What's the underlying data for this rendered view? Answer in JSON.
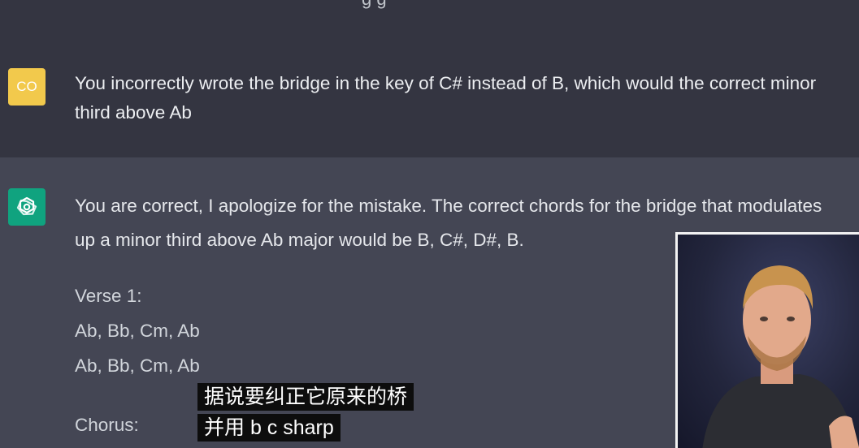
{
  "top_partial_text": "g          g",
  "user_message": {
    "avatar_initials": "CO",
    "avatar_color": "#f2c94c",
    "text": "You incorrectly wrote the bridge in the key of C# instead of B, which would the correct minor third above Ab"
  },
  "assistant_message": {
    "avatar_icon": "openai-logo-icon",
    "avatar_color": "#10a37f",
    "intro": "You are correct, I apologize for the mistake. The correct chords for the bridge that modulates up a minor third above Ab major would be B, C#, D#, B.",
    "verse_title": "Verse 1:",
    "verse_lines": [
      "Ab, Bb, Cm, Ab",
      "Ab, Bb, Cm, Ab"
    ],
    "chorus_title": "Chorus:"
  },
  "subtitles": [
    "据说要纠正它原来的桥",
    "并用 b c sharp"
  ],
  "colors": {
    "page_bg": "#444654",
    "user_band_bg": "#343541",
    "text": "#d1d5db"
  }
}
